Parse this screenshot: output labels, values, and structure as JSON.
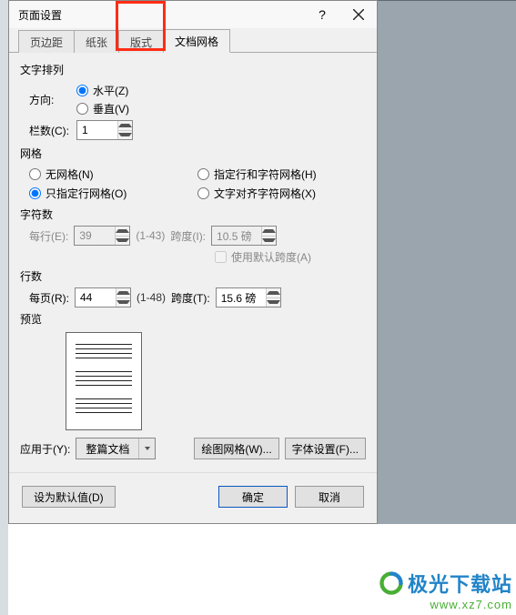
{
  "dialog": {
    "title": "页面设置",
    "tabs": [
      "页边距",
      "纸张",
      "版式",
      "文档网格"
    ],
    "active_tab": 3
  },
  "text_arrange": {
    "section": "文字排列",
    "direction_label": "方向:",
    "horizontal": "水平(Z)",
    "vertical": "垂直(V)",
    "columns_label": "栏数(C):",
    "columns_value": "1"
  },
  "grid": {
    "section": "网格",
    "none": "无网格(N)",
    "line_only": "只指定行网格(O)",
    "line_char": "指定行和字符网格(H)",
    "align_char": "文字对齐字符网格(X)"
  },
  "chars": {
    "section": "字符数",
    "per_line_label": "每行(E):",
    "per_line_value": "39",
    "per_line_range": "(1-43)",
    "pitch_label": "跨度(I):",
    "pitch_value": "10.5 磅",
    "use_default": "使用默认跨度(A)"
  },
  "lines": {
    "section": "行数",
    "per_page_label": "每页(R):",
    "per_page_value": "44",
    "per_page_range": "(1-48)",
    "pitch_label": "跨度(T):",
    "pitch_value": "15.6 磅"
  },
  "preview": {
    "section": "预览"
  },
  "apply": {
    "label": "应用于(Y):",
    "value": "整篇文档",
    "draw_grid_btn": "绘图网格(W)...",
    "font_btn": "字体设置(F)..."
  },
  "footer": {
    "set_default": "设为默认值(D)",
    "ok": "确定",
    "cancel": "取消"
  },
  "watermark": {
    "brand": "极光下载站",
    "url": "www.xz7.com"
  }
}
